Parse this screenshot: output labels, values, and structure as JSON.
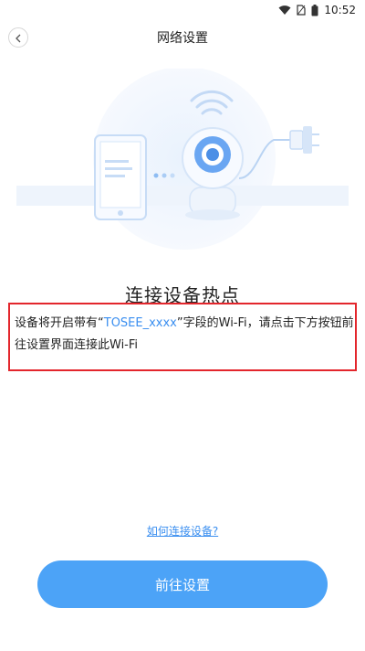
{
  "status_bar": {
    "time": "10:52",
    "icons": [
      "wifi-icon",
      "no-sim-icon",
      "battery-icon"
    ]
  },
  "header": {
    "title": "网络设置",
    "back_icon": "chevron-left-icon"
  },
  "illustration": {
    "icons": [
      "phone-icon",
      "camera-icon",
      "wifi-signal-icon",
      "power-plug-icon"
    ]
  },
  "main": {
    "heading": "连接设备热点",
    "description_prefix": "设备将开启带有“",
    "description_highlight": "TOSEE_xxxx",
    "description_suffix": "”字段的Wi-Fi，请点击下方按钮前往设置界面连接此Wi-Fi"
  },
  "help_link": "如何连接设备?",
  "primary_button": "前往设置",
  "colors": {
    "accent": "#3b8ff0",
    "button": "#4ca3f7",
    "highlight_border": "#e3262c"
  }
}
